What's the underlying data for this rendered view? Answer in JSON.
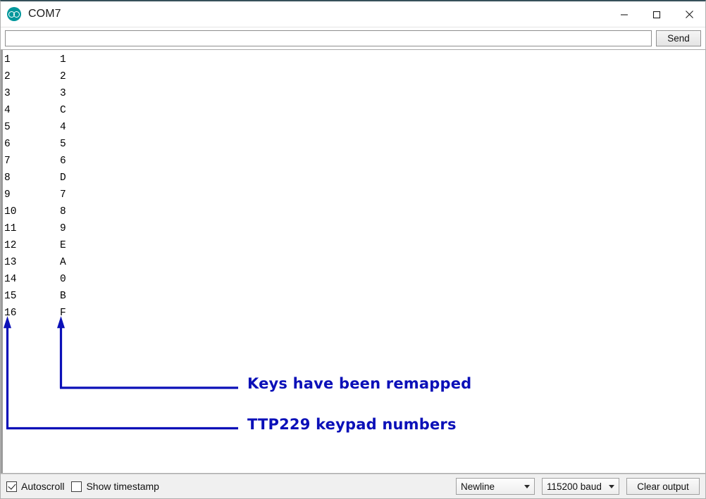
{
  "window": {
    "title": "COM7",
    "logo_icon": "arduino-logo-icon",
    "controls": {
      "minimize": "minimize-icon",
      "maximize": "maximize-icon",
      "close": "close-icon"
    }
  },
  "send_row": {
    "input_value": "",
    "input_placeholder": "",
    "send_label": "Send"
  },
  "console": {
    "columns": [
      "keypad_number",
      "remapped_key"
    ],
    "lines": [
      {
        "a": "1",
        "b": "1"
      },
      {
        "a": "2",
        "b": "2"
      },
      {
        "a": "3",
        "b": "3"
      },
      {
        "a": "4",
        "b": "C"
      },
      {
        "a": "5",
        "b": "4"
      },
      {
        "a": "6",
        "b": "5"
      },
      {
        "a": "7",
        "b": "6"
      },
      {
        "a": "8",
        "b": "D"
      },
      {
        "a": "9",
        "b": "7"
      },
      {
        "a": "10",
        "b": "8"
      },
      {
        "a": "11",
        "b": "9"
      },
      {
        "a": "12",
        "b": "E"
      },
      {
        "a": "13",
        "b": "A"
      },
      {
        "a": "14",
        "b": "0"
      },
      {
        "a": "15",
        "b": "B"
      },
      {
        "a": "16",
        "b": "F"
      }
    ]
  },
  "annotations": {
    "color": "#0b10b8",
    "items": [
      {
        "text": "Keys have been remapped"
      },
      {
        "text": "TTP229 keypad numbers"
      }
    ]
  },
  "statusbar": {
    "autoscroll_label": "Autoscroll",
    "autoscroll_checked": true,
    "timestamp_label": "Show timestamp",
    "timestamp_checked": false,
    "line_ending": "Newline",
    "baud_rate": "115200 baud",
    "clear_output_label": "Clear output"
  }
}
